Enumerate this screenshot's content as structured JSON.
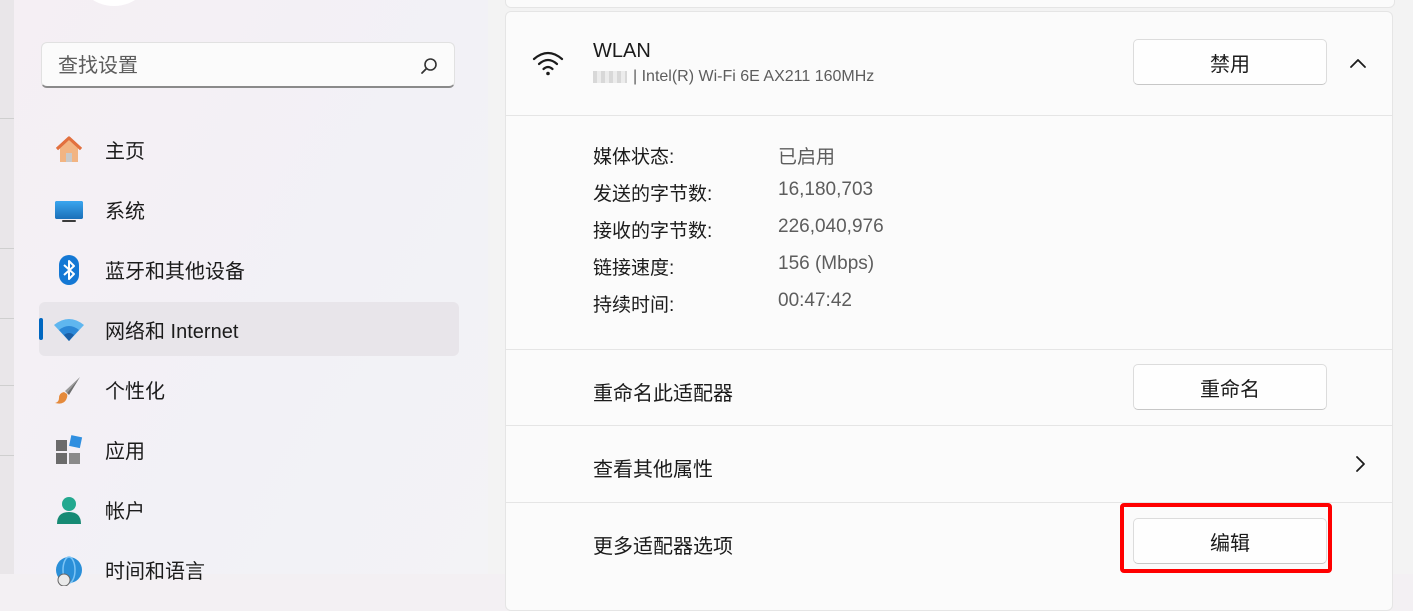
{
  "search": {
    "placeholder": "查找设置"
  },
  "nav": {
    "items": [
      {
        "label": "主页",
        "icon": "home-icon"
      },
      {
        "label": "系统",
        "icon": "system-display-icon"
      },
      {
        "label": "蓝牙和其他设备",
        "icon": "bluetooth-icon"
      },
      {
        "label": "网络和 Internet",
        "icon": "network-wifi-icon",
        "active": true
      },
      {
        "label": "个性化",
        "icon": "brush-icon"
      },
      {
        "label": "应用",
        "icon": "apps-icon"
      },
      {
        "label": "帐户",
        "icon": "account-icon"
      },
      {
        "label": "时间和语言",
        "icon": "globe-clock-icon"
      }
    ]
  },
  "adapter": {
    "name": "WLAN",
    "description": "| Intel(R) Wi-Fi 6E AX211 160MHz",
    "disable_label": "禁用"
  },
  "properties": [
    {
      "key": "媒体状态:",
      "value": "已启用"
    },
    {
      "key": "发送的字节数:",
      "value": "16,180,703"
    },
    {
      "key": "接收的字节数:",
      "value": "226,040,976"
    },
    {
      "key": "链接速度:",
      "value": "156 (Mbps)"
    },
    {
      "key": "持续时间:",
      "value": "00:47:42"
    }
  ],
  "rename": {
    "label": "重命名此适配器",
    "button": "重命名"
  },
  "more_props": {
    "label": "查看其他属性"
  },
  "more_options": {
    "label": "更多适配器选项",
    "button": "编辑"
  },
  "colors": {
    "accent": "#0067c0",
    "highlight": "#ff0000"
  }
}
